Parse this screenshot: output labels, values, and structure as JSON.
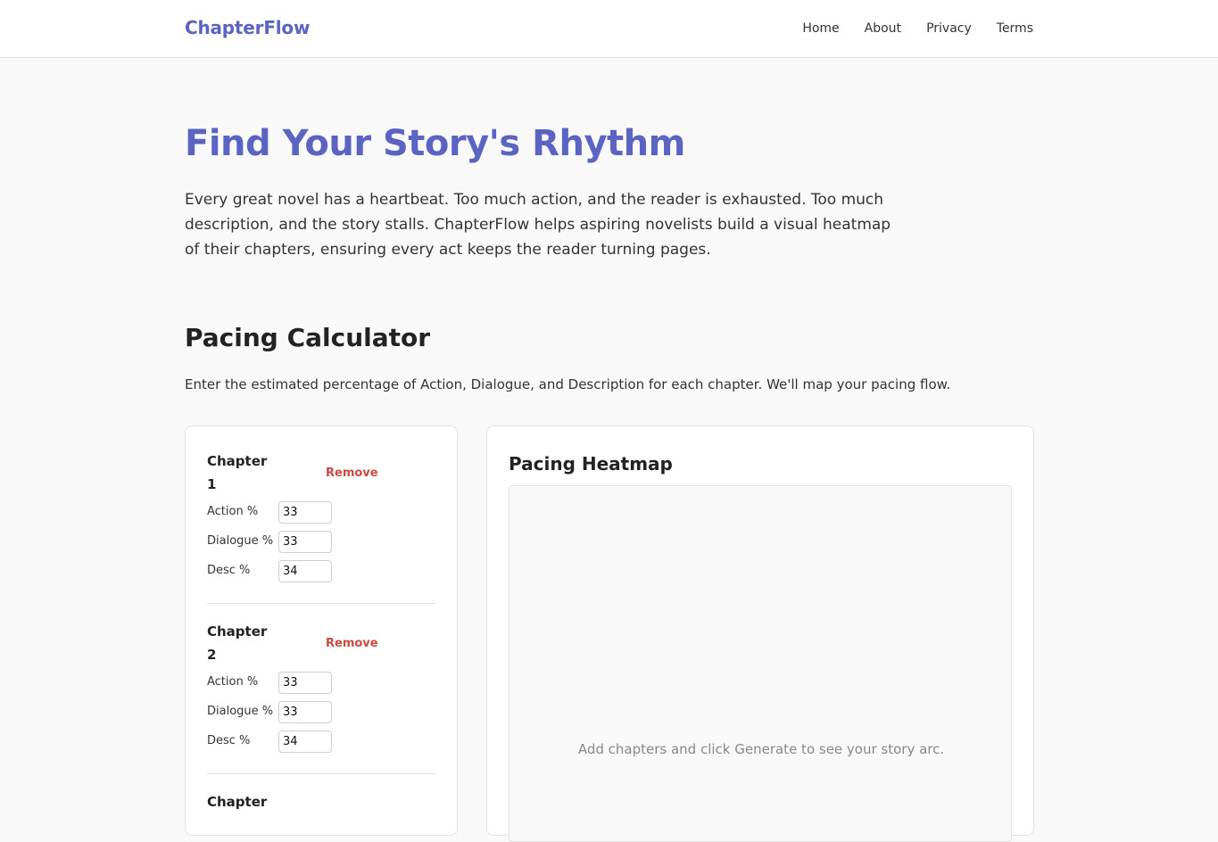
{
  "brand": "ChapterFlow",
  "nav": [
    "Home",
    "About",
    "Privacy",
    "Terms"
  ],
  "hero": {
    "title": "Find Your Story's Rhythm",
    "text": "Every great novel has a heartbeat. Too much action, and the reader is exhausted. Too much description, and the story stalls. ChapterFlow helps aspiring novelists build a visual heatmap of their chapters, ensuring every act keeps the reader turning pages."
  },
  "calculator": {
    "title": "Pacing Calculator",
    "description": "Enter the estimated percentage of Action, Dialogue, and Description for each chapter. We'll map your pacing flow.",
    "remove_label": "Remove",
    "field_labels": {
      "action": "Action %",
      "dialogue": "Dialogue %",
      "desc": "Desc %"
    },
    "chapters": [
      {
        "title": "Chapter 1",
        "action": "33",
        "dialogue": "33",
        "desc": "34"
      },
      {
        "title": "Chapter 2",
        "action": "33",
        "dialogue": "33",
        "desc": "34"
      },
      {
        "title": "Chapter"
      }
    ]
  },
  "heatmap": {
    "title": "Pacing Heatmap",
    "empty_message": "Add chapters and click Generate to see your story arc."
  },
  "colors": {
    "accent": "#5b64c3",
    "danger": "#c94a42",
    "background": "#f9f9f9"
  }
}
